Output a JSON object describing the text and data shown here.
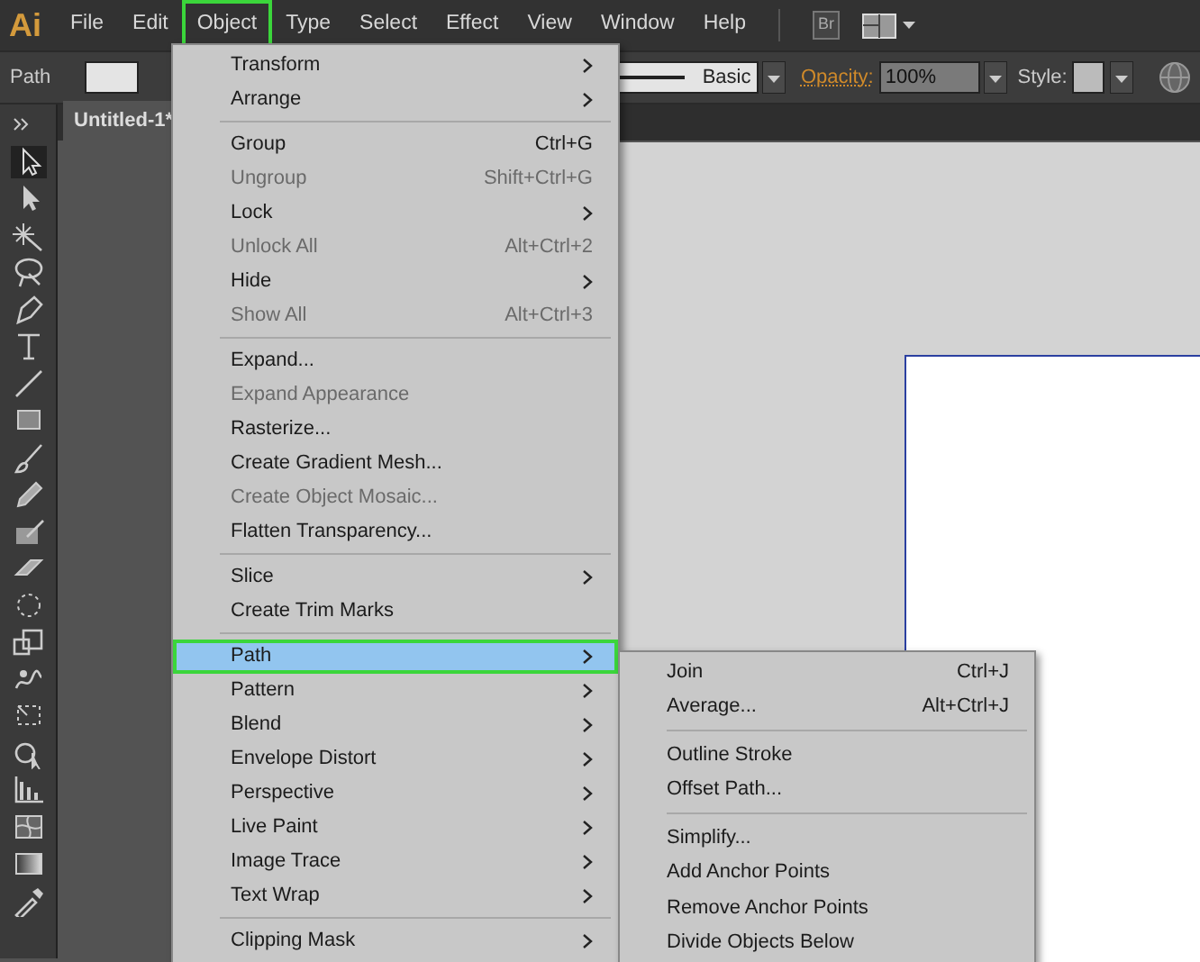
{
  "app": {
    "logo": "Ai"
  },
  "menubar": [
    {
      "label": "File",
      "highlighted": false
    },
    {
      "label": "Edit",
      "highlighted": false
    },
    {
      "label": "Object",
      "highlighted": true
    },
    {
      "label": "Type",
      "highlighted": false
    },
    {
      "label": "Select",
      "highlighted": false
    },
    {
      "label": "Effect",
      "highlighted": false
    },
    {
      "label": "View",
      "highlighted": false
    },
    {
      "label": "Window",
      "highlighted": false
    },
    {
      "label": "Help",
      "highlighted": false
    }
  ],
  "bridge_button": {
    "label": "Br"
  },
  "control_bar": {
    "selection": "Path",
    "brush": "Basic",
    "opacity_label": "Opacity:",
    "opacity": "100%",
    "style_label": "Style:"
  },
  "document_tab": {
    "title": "Untitled-1*"
  },
  "object_menu": [
    {
      "kind": "item",
      "label": "Transform",
      "submenu": true,
      "disabled": false,
      "selected": false,
      "highlighted": false
    },
    {
      "kind": "item",
      "label": "Arrange",
      "submenu": true,
      "disabled": false,
      "selected": false,
      "highlighted": false
    },
    {
      "kind": "separator"
    },
    {
      "kind": "item",
      "label": "Group",
      "shortcut": "Ctrl+G",
      "submenu": false,
      "disabled": false,
      "selected": false,
      "highlighted": false
    },
    {
      "kind": "item",
      "label": "Ungroup",
      "shortcut": "Shift+Ctrl+G",
      "submenu": false,
      "disabled": true,
      "selected": false,
      "highlighted": false
    },
    {
      "kind": "item",
      "label": "Lock",
      "submenu": true,
      "disabled": false,
      "selected": false,
      "highlighted": false
    },
    {
      "kind": "item",
      "label": "Unlock All",
      "shortcut": "Alt+Ctrl+2",
      "submenu": false,
      "disabled": true,
      "selected": false,
      "highlighted": false
    },
    {
      "kind": "item",
      "label": "Hide",
      "submenu": true,
      "disabled": false,
      "selected": false,
      "highlighted": false
    },
    {
      "kind": "item",
      "label": "Show All",
      "shortcut": "Alt+Ctrl+3",
      "submenu": false,
      "disabled": true,
      "selected": false,
      "highlighted": false
    },
    {
      "kind": "separator"
    },
    {
      "kind": "item",
      "label": "Expand...",
      "submenu": false,
      "disabled": false,
      "selected": false,
      "highlighted": false
    },
    {
      "kind": "item",
      "label": "Expand Appearance",
      "submenu": false,
      "disabled": true,
      "selected": false,
      "highlighted": false
    },
    {
      "kind": "item",
      "label": "Rasterize...",
      "submenu": false,
      "disabled": false,
      "selected": false,
      "highlighted": false
    },
    {
      "kind": "item",
      "label": "Create Gradient Mesh...",
      "submenu": false,
      "disabled": false,
      "selected": false,
      "highlighted": false
    },
    {
      "kind": "item",
      "label": "Create Object Mosaic...",
      "submenu": false,
      "disabled": true,
      "selected": false,
      "highlighted": false
    },
    {
      "kind": "item",
      "label": "Flatten Transparency...",
      "submenu": false,
      "disabled": false,
      "selected": false,
      "highlighted": false
    },
    {
      "kind": "separator"
    },
    {
      "kind": "item",
      "label": "Slice",
      "submenu": true,
      "disabled": false,
      "selected": false,
      "highlighted": false
    },
    {
      "kind": "item",
      "label": "Create Trim Marks",
      "submenu": false,
      "disabled": false,
      "selected": false,
      "highlighted": false
    },
    {
      "kind": "separator"
    },
    {
      "kind": "item",
      "label": "Path",
      "submenu": true,
      "disabled": false,
      "selected": true,
      "highlighted": true
    },
    {
      "kind": "item",
      "label": "Pattern",
      "submenu": true,
      "disabled": false,
      "selected": false,
      "highlighted": false
    },
    {
      "kind": "item",
      "label": "Blend",
      "submenu": true,
      "disabled": false,
      "selected": false,
      "highlighted": false
    },
    {
      "kind": "item",
      "label": "Envelope Distort",
      "submenu": true,
      "disabled": false,
      "selected": false,
      "highlighted": false
    },
    {
      "kind": "item",
      "label": "Perspective",
      "submenu": true,
      "disabled": false,
      "selected": false,
      "highlighted": false
    },
    {
      "kind": "item",
      "label": "Live Paint",
      "submenu": true,
      "disabled": false,
      "selected": false,
      "highlighted": false
    },
    {
      "kind": "item",
      "label": "Image Trace",
      "submenu": true,
      "disabled": false,
      "selected": false,
      "highlighted": false
    },
    {
      "kind": "item",
      "label": "Text Wrap",
      "submenu": true,
      "disabled": false,
      "selected": false,
      "highlighted": false
    },
    {
      "kind": "separator"
    },
    {
      "kind": "item",
      "label": "Clipping Mask",
      "submenu": true,
      "disabled": false,
      "selected": false,
      "highlighted": false
    }
  ],
  "path_submenu": [
    {
      "kind": "item",
      "label": "Join",
      "shortcut": "Ctrl+J"
    },
    {
      "kind": "item",
      "label": "Average...",
      "shortcut": "Alt+Ctrl+J"
    },
    {
      "kind": "separator"
    },
    {
      "kind": "item",
      "label": "Outline Stroke"
    },
    {
      "kind": "item",
      "label": "Offset Path..."
    },
    {
      "kind": "separator"
    },
    {
      "kind": "item",
      "label": "Simplify..."
    },
    {
      "kind": "item",
      "label": "Add Anchor Points"
    },
    {
      "kind": "item",
      "label": "Remove Anchor Points"
    },
    {
      "kind": "item",
      "label": "Divide Objects Below"
    }
  ]
}
